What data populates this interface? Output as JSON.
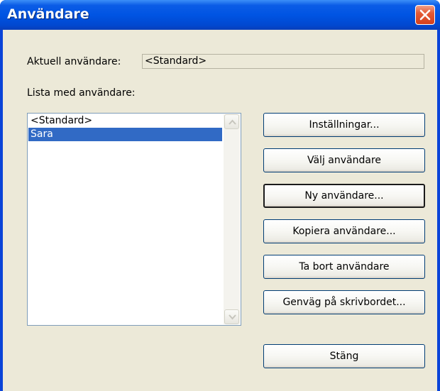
{
  "window": {
    "title": "Användare"
  },
  "current_user": {
    "label": "Aktuell användare:",
    "value": "<Standard>"
  },
  "user_list": {
    "label": "Lista med användare:",
    "items": [
      "<Standard>",
      "Sara"
    ],
    "selected_item": "Sara"
  },
  "buttons": {
    "settings": "Inställningar...",
    "select_user": "Välj användare",
    "new_user": "Ny användare...",
    "copy_user": "Kopiera användare...",
    "delete_user": "Ta bort användare",
    "desktop_shortcut": "Genväg på skrivbordet...",
    "close": "Stäng"
  },
  "icons": {
    "close": "close-icon",
    "scroll_up": "chevron-up-icon",
    "scroll_down": "chevron-down-icon"
  },
  "colors": {
    "titlebar": "#0054e3",
    "dialog_background": "#ece9d8",
    "selection": "#316ac5",
    "close_button": "#e45a35"
  }
}
